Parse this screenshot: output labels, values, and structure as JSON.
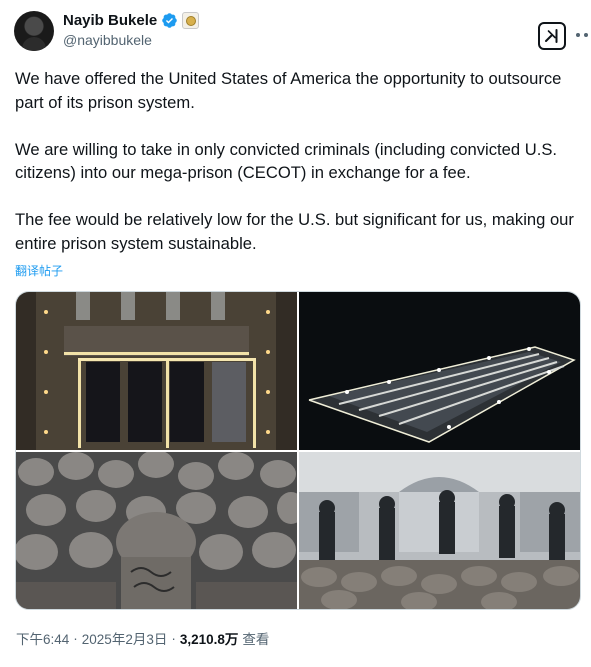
{
  "author": {
    "display_name": "Nayib Bukele",
    "handle": "@nayibbukele",
    "verified": true
  },
  "tweet": {
    "paragraphs": [
      "We have offered the United States of America the opportunity to outsource part of its prison system.",
      "We are willing to take in only convicted criminals (including convicted U.S. citizens) into our mega-prison (CECOT) in exchange for a fee.",
      "The fee would be relatively low for the U.S. but significant for us, making our entire prison system sustainable."
    ],
    "translate_label": "翻译帖子"
  },
  "media": {
    "count": 4,
    "photos": [
      "aerial-prison-night-photo",
      "prison-complex-lights-photo",
      "inmates-seated-photo",
      "guards-inmates-hall-photo"
    ]
  },
  "meta": {
    "time": "下午6:44",
    "separator": "·",
    "date": "2025年2月3日",
    "separator2": "·",
    "views": "3,210.8万",
    "views_label": "查看"
  },
  "icons": {
    "verified": "verified-badge-icon",
    "affiliation": "affiliation-badge-icon",
    "grok": "grok-icon",
    "more": "more-options-icon"
  },
  "colors": {
    "text": "#0f1419",
    "secondary": "#536471",
    "link": "#1d9bf0",
    "verified": "#1d9bf0"
  }
}
